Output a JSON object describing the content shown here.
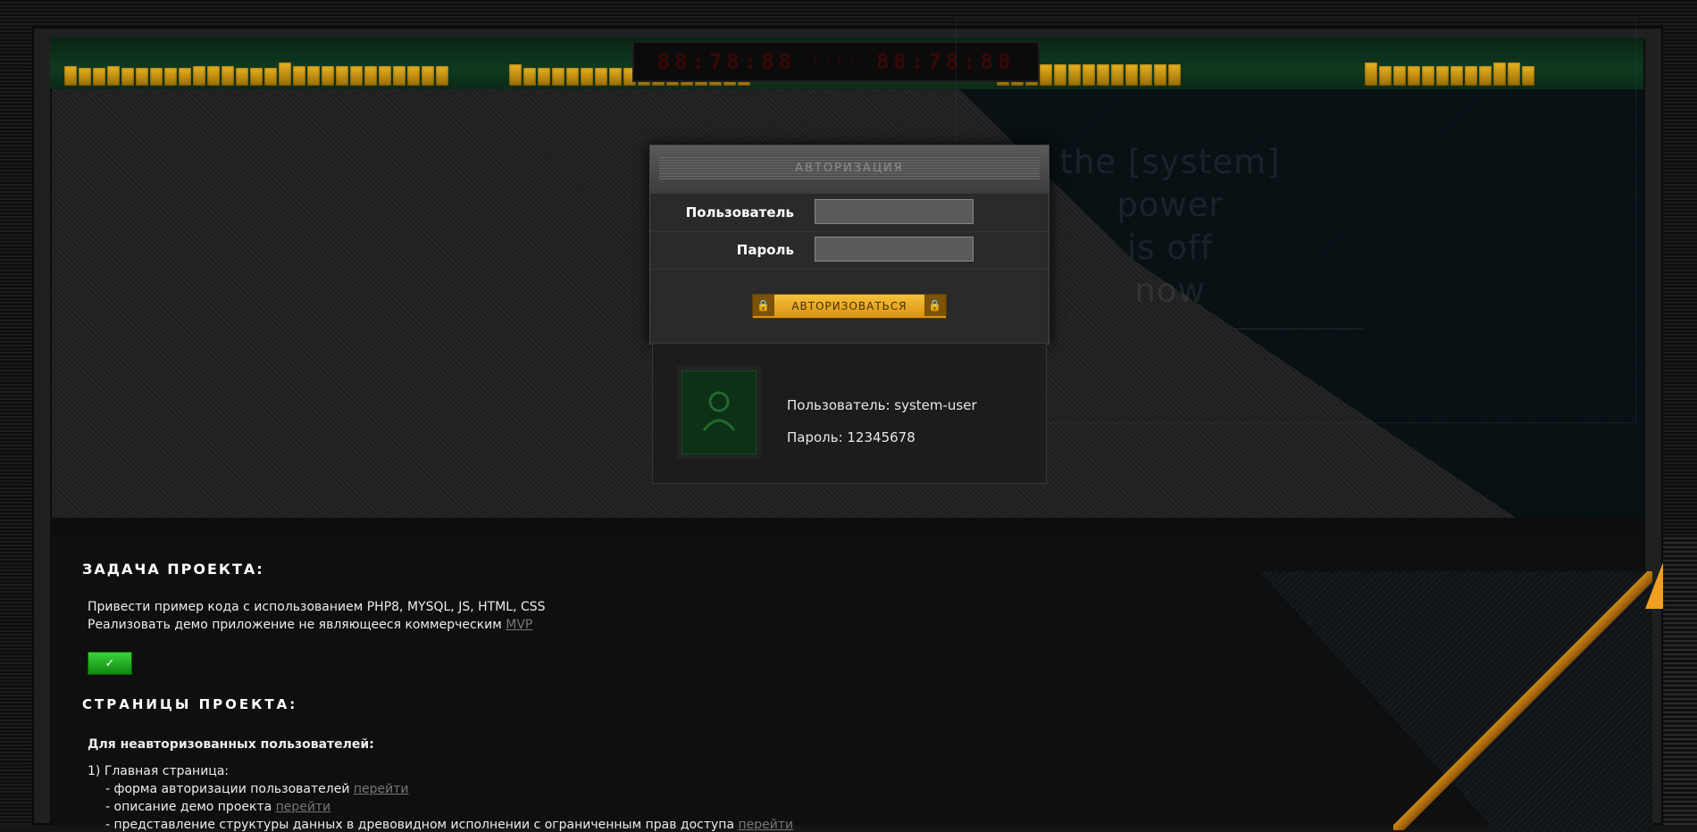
{
  "led": {
    "left": "88:78:88",
    "mid": "::::",
    "right": "88:78:88"
  },
  "hero": {
    "system_text": [
      "the [system]",
      "power",
      "is off",
      "now"
    ]
  },
  "login": {
    "title": "АВТОРИЗАЦИЯ",
    "user_label": "Пользователь",
    "password_label": "Пароль",
    "user_value": "",
    "password_value": "",
    "submit_label": "АВТОРИЗОВАТЬСЯ",
    "lock_icon": "🔒"
  },
  "credentials": {
    "user_line": "Пользователь: system-user",
    "password_line": "Пароль: 12345678"
  },
  "project": {
    "task_title": "ЗАДАЧА ПРОЕКТА:",
    "task_line1": "Привести пример кода с использованием PHP8, MYSQL, JS, HTML, CSS",
    "task_line2": "Реализовать демо приложение не являющееся коммерческим",
    "mvp_link": "MVP",
    "ok_label": "✓",
    "pages_title": "СТРАНИЦЫ ПРОЕКТА:",
    "unauth_title": "Для неавторизованных пользователей:",
    "item1": "1) Главная страница:",
    "sub1": "- форма авторизации пользователей",
    "sub2": "- описание демо проекта",
    "sub3": "- представление структуры данных в древовидном исполнении с ограниченным прав доступа",
    "link_label": "перейти"
  },
  "colors": {
    "accent_gold": "#e8b21f",
    "accent_green": "#0f3a1f",
    "button_green": "#1fae1f"
  }
}
